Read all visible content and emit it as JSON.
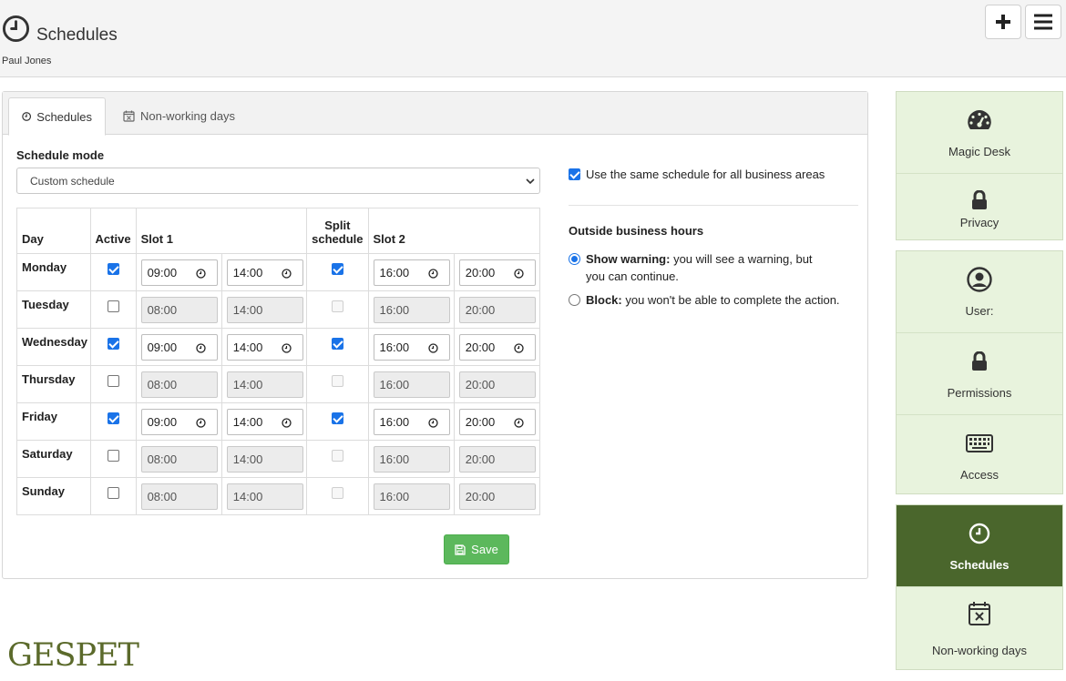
{
  "header": {
    "title": "Schedules",
    "user_name": "Paul Jones",
    "add_icon": "plus-icon",
    "menu_icon": "hamburger-icon"
  },
  "tabs": [
    {
      "label": "Schedules",
      "icon": "clock-icon",
      "active": true
    },
    {
      "label": "Non-working days",
      "icon": "calendar-x-icon",
      "active": false
    }
  ],
  "schedule_mode": {
    "label": "Schedule mode",
    "selected": "Custom schedule"
  },
  "table": {
    "headers": {
      "day": "Day",
      "active": "Active",
      "slot1": "Slot 1",
      "split": "Split schedule",
      "slot2": "Slot 2"
    },
    "rows": [
      {
        "day": "Monday",
        "active": true,
        "s1_start": "09:00",
        "s1_end": "14:00",
        "split": true,
        "s2_start": "16:00",
        "s2_end": "20:00"
      },
      {
        "day": "Tuesday",
        "active": false,
        "s1_start": "08:00",
        "s1_end": "14:00",
        "split": false,
        "s2_start": "16:00",
        "s2_end": "20:00"
      },
      {
        "day": "Wednesday",
        "active": true,
        "s1_start": "09:00",
        "s1_end": "14:00",
        "split": true,
        "s2_start": "16:00",
        "s2_end": "20:00"
      },
      {
        "day": "Thursday",
        "active": false,
        "s1_start": "08:00",
        "s1_end": "14:00",
        "split": false,
        "s2_start": "16:00",
        "s2_end": "20:00"
      },
      {
        "day": "Friday",
        "active": true,
        "s1_start": "09:00",
        "s1_end": "14:00",
        "split": true,
        "s2_start": "16:00",
        "s2_end": "20:00"
      },
      {
        "day": "Saturday",
        "active": false,
        "s1_start": "08:00",
        "s1_end": "14:00",
        "split": false,
        "s2_start": "16:00",
        "s2_end": "20:00"
      },
      {
        "day": "Sunday",
        "active": false,
        "s1_start": "08:00",
        "s1_end": "14:00",
        "split": false,
        "s2_start": "16:00",
        "s2_end": "20:00"
      }
    ]
  },
  "save_button": {
    "label": "Save",
    "icon": "save-icon"
  },
  "same_schedule": {
    "label": "Use the same schedule for all business areas",
    "checked": true
  },
  "outside_hours": {
    "label": "Outside business hours",
    "options": [
      {
        "bold": "Show warning:",
        "text_line1": " you will see a warning, but",
        "text_line2": "you can continue.",
        "checked": true
      },
      {
        "bold": "Block:",
        "text_line1": " you won't be able to complete the action.",
        "text_line2": "",
        "checked": false
      }
    ]
  },
  "logo_text": "GESPET",
  "sidebar": {
    "groups": [
      {
        "items": [
          {
            "label": "Magic Desk",
            "icon": "speedometer-icon",
            "active": false
          },
          {
            "label": "Privacy",
            "icon": "lock-icon",
            "active": false
          }
        ]
      },
      {
        "items": [
          {
            "label": "User:",
            "icon": "user-circle-icon",
            "active": false
          },
          {
            "label": "Permissions",
            "icon": "lock-icon",
            "active": false
          },
          {
            "label": "Access",
            "icon": "keyboard-icon",
            "active": false
          }
        ]
      },
      {
        "items": [
          {
            "label": "Schedules",
            "icon": "clock-icon",
            "active": true
          },
          {
            "label": "Non-working days",
            "icon": "calendar-x-icon",
            "active": false
          }
        ]
      }
    ]
  },
  "colors": {
    "accent_green": "#5cb85c",
    "sidebar_bg": "#e8f3dd",
    "sidebar_active": "#4a662c",
    "checkbox_blue": "#1a73e8"
  }
}
